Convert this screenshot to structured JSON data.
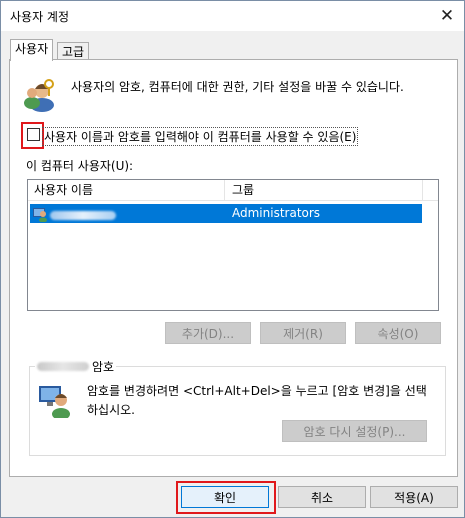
{
  "window": {
    "title": "사용자 계정",
    "close_glyph": "✕"
  },
  "tabs": [
    {
      "label": "사용자",
      "active": true
    },
    {
      "label": "고급",
      "active": false
    }
  ],
  "info": {
    "icon": "users-keys-icon",
    "text": "사용자의 암호, 컴퓨터에 대한 권한, 기타 설정을 바꿀 수 있습니다."
  },
  "require_password": {
    "checked": false,
    "label": "사용자 이름과 암호를 입력해야 이 컴퓨터를 사용할 수 있음(E)"
  },
  "users_list": {
    "label": "이 컴퓨터 사용자(U):",
    "columns": [
      "사용자 이름",
      "그룹"
    ],
    "rows": [
      {
        "name": "",
        "group": "Administrators",
        "selected": true
      }
    ]
  },
  "list_buttons": {
    "add": "추가(D)...",
    "remove": "제거(R)",
    "properties": "속성(O)"
  },
  "password_group": {
    "title_suffix": "암호",
    "text": "암호를 변경하려면 <Ctrl+Alt+Del>을 누르고 [암호 변경]을 선택하십시오.",
    "reset_button": "암호 다시 설정(P)..."
  },
  "dialog_buttons": {
    "ok": "확인",
    "cancel": "취소",
    "apply": "적용(A)"
  },
  "colors": {
    "selection": "#0078d7",
    "highlight_red": "#e0181b"
  }
}
